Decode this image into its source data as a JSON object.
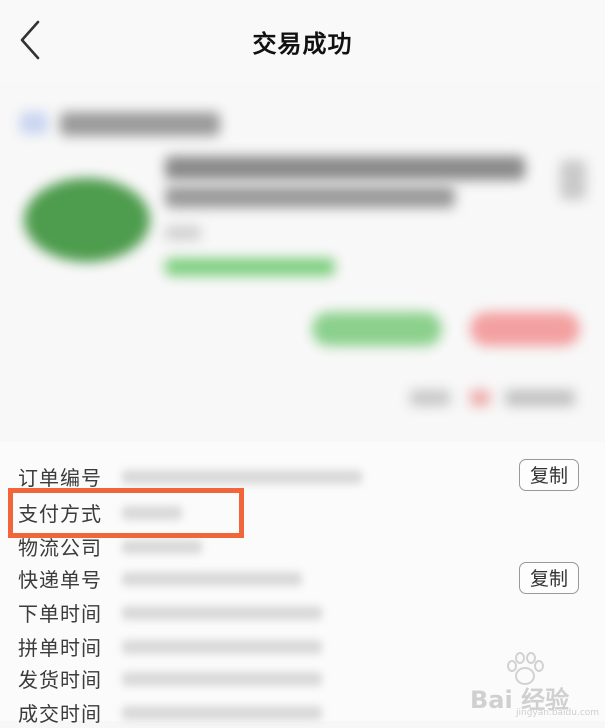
{
  "header": {
    "title": "交易成功",
    "back_icon": "chevron-left-icon"
  },
  "colors": {
    "highlight": "#f0663a",
    "background": "#f7f7f7",
    "label_text": "#3b3b3b"
  },
  "order_info": {
    "rows": [
      {
        "label": "订单编号",
        "copy_label": "复制"
      },
      {
        "label": "支付方式"
      },
      {
        "label": "物流公司"
      },
      {
        "label": "快递单号",
        "copy_label": "复制"
      },
      {
        "label": "下单时间"
      },
      {
        "label": "拼单时间"
      },
      {
        "label": "发货时间"
      },
      {
        "label": "成交时间"
      }
    ]
  },
  "watermark": {
    "text": "Bai 经验",
    "url": "jingyan.baidu.com"
  }
}
